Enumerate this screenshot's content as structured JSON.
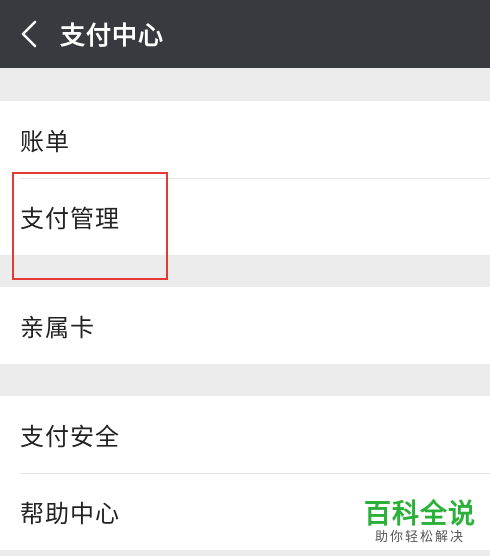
{
  "header": {
    "back_icon": "chevron-left-icon",
    "title": "支付中心"
  },
  "groups": [
    {
      "items": [
        {
          "label": "账单"
        },
        {
          "label": "支付管理"
        }
      ]
    },
    {
      "items": [
        {
          "label": "亲属卡"
        }
      ]
    },
    {
      "items": [
        {
          "label": "支付安全"
        },
        {
          "label": "帮助中心"
        }
      ]
    }
  ],
  "watermark": {
    "main": "百科全说",
    "sub": "助你轻松解决"
  },
  "colors": {
    "header_bg": "#393a3f",
    "page_bg": "#ececec",
    "highlight": "#e53935",
    "watermark_green": "#2bb03a"
  }
}
